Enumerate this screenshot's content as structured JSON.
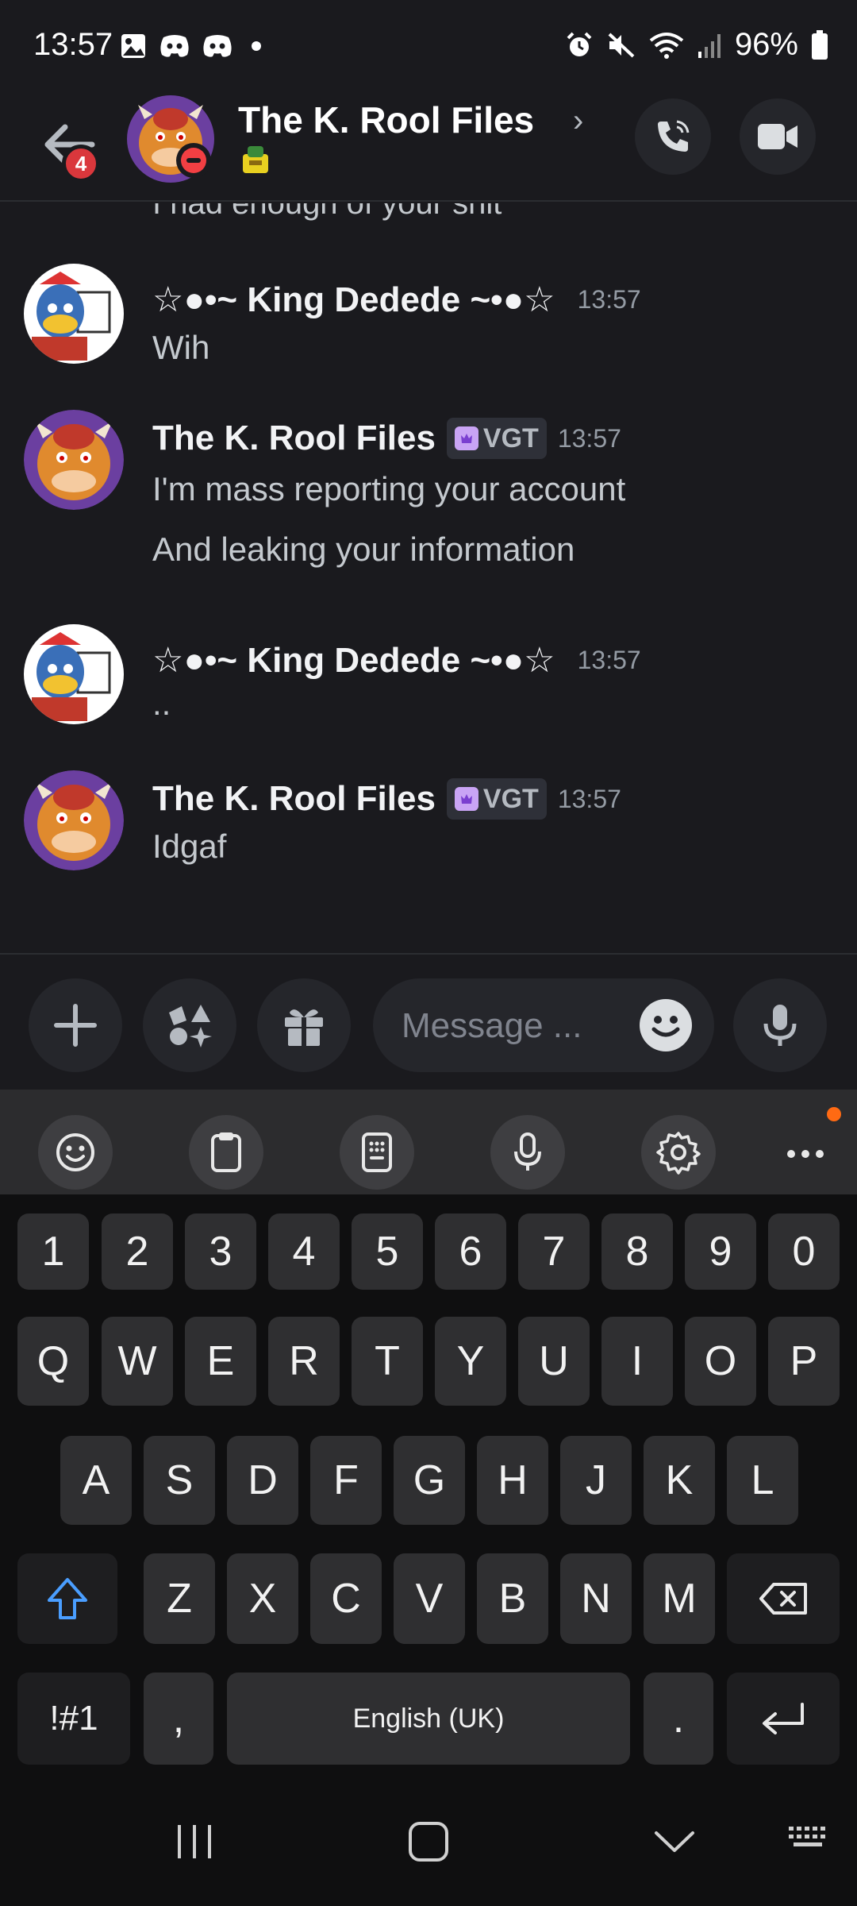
{
  "status_bar": {
    "time": "13:57",
    "battery": "96%",
    "icons": [
      "gallery-icon",
      "discord-icon",
      "discord-icon",
      "dot-icon",
      "alarm-icon",
      "mute-icon",
      "wifi-icon",
      "signal-icon",
      "battery-icon"
    ]
  },
  "header": {
    "unread_badge": "4",
    "title": "The K. Rool Files",
    "chevron": "›"
  },
  "messages": {
    "cut_off_text": "I had enough of your shit",
    "items": [
      {
        "author": "☆●•~ King Dedede ~•●☆",
        "time": "13:57",
        "lines": [
          "Wih"
        ]
      },
      {
        "author": "The K. Rool Files",
        "tag": "VGT",
        "time": "13:57",
        "lines": [
          "I'm mass reporting your account",
          "And leaking your information"
        ]
      },
      {
        "author": "☆●•~ King Dedede ~•●☆",
        "time": "13:57",
        "lines": [
          ".."
        ]
      },
      {
        "author": "The K. Rool Files",
        "tag": "VGT",
        "time": "13:57",
        "lines": [
          "Idgaf"
        ]
      }
    ]
  },
  "composer": {
    "placeholder": "Message ..."
  },
  "keyboard": {
    "row_numbers": [
      "1",
      "2",
      "3",
      "4",
      "5",
      "6",
      "7",
      "8",
      "9",
      "0"
    ],
    "row_q": [
      "Q",
      "W",
      "E",
      "R",
      "T",
      "Y",
      "U",
      "I",
      "O",
      "P"
    ],
    "row_a": [
      "A",
      "S",
      "D",
      "F",
      "G",
      "H",
      "J",
      "K",
      "L"
    ],
    "row_z": [
      "Z",
      "X",
      "C",
      "V",
      "B",
      "N",
      "M"
    ],
    "symbols_key": "!#1",
    "comma_key": ",",
    "space_key": "English (UK)",
    "period_key": "."
  },
  "colors": {
    "background": "#1a1a1e",
    "badge_red": "#da373c",
    "dnd_red": "#f23f43",
    "shift_blue": "#4a9eff",
    "notification_orange": "#ff6a13"
  }
}
